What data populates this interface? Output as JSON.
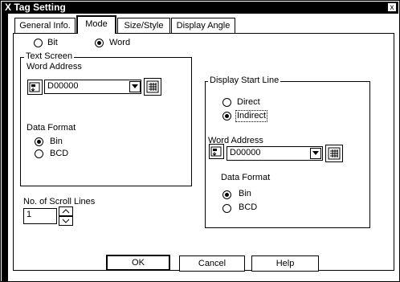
{
  "window": {
    "title": "X Tag Setting",
    "close_glyph": "x"
  },
  "tabs": [
    {
      "label": "General Info."
    },
    {
      "label": "Mode"
    },
    {
      "label": "Size/Style"
    },
    {
      "label": "Display Angle"
    }
  ],
  "mode": {
    "bit_label": "Bit",
    "word_label": "Word",
    "selected": "Word"
  },
  "text_screen": {
    "title": "Text Screen",
    "word_address_label": "Word Address",
    "word_address_value": "D00000",
    "data_format_label": "Data Format",
    "bin_label": "Bin",
    "bcd_label": "BCD",
    "selected_format": "Bin"
  },
  "scroll": {
    "label": "No. of Scroll Lines",
    "value": "1"
  },
  "display_start": {
    "title": "Display Start Line",
    "direct_label": "Direct",
    "indirect_label": "Indirect",
    "selected": "Indirect",
    "word_address_label": "Word Address",
    "word_address_value": "D00000",
    "data_format_label": "Data Format",
    "bin_label": "Bin",
    "bcd_label": "BCD",
    "selected_format": "Bin"
  },
  "buttons": {
    "ok": "OK",
    "cancel": "Cancel",
    "help": "Help"
  }
}
